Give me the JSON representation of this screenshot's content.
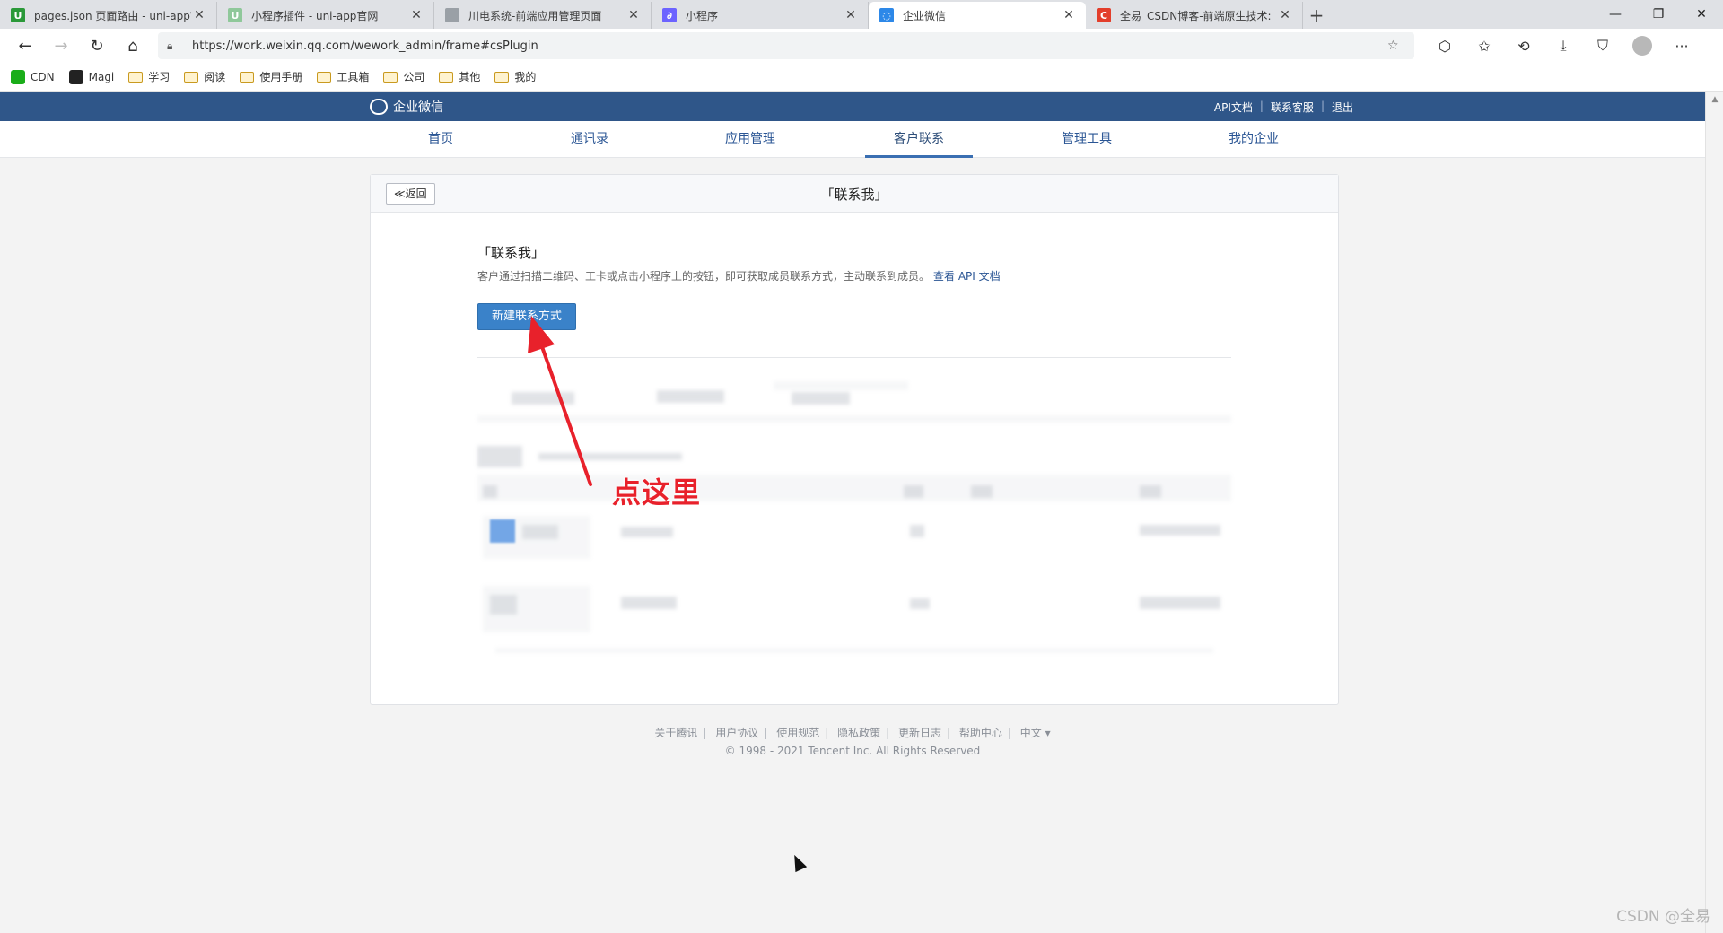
{
  "browser": {
    "tabs": [
      {
        "title": "pages.json 页面路由 - uni-app官",
        "favicon_color": "#2b9939",
        "favicon_glyph": "U",
        "active": false
      },
      {
        "title": "小程序插件 - uni-app官网",
        "favicon_color": "#8fc89a",
        "favicon_glyph": "U",
        "active": false
      },
      {
        "title": "川电系统-前端应用管理页面",
        "favicon_color": "#9aa0a6",
        "favicon_glyph": "",
        "active": false
      },
      {
        "title": "小程序",
        "favicon_color": "#6c63ff",
        "favicon_glyph": "∂",
        "active": false
      },
      {
        "title": "企业微信",
        "favicon_color": "#2d88e8",
        "favicon_glyph": "◌",
        "active": true
      },
      {
        "title": "全易_CSDN博客-前端原生技术:",
        "favicon_color": "#e33e2b",
        "favicon_glyph": "C",
        "active": false
      }
    ],
    "url": "https://work.weixin.qq.com/wework_admin/frame#csPlugin",
    "bookmarks": [
      {
        "label": "CDN",
        "type": "site",
        "color": "#1aad19"
      },
      {
        "label": "Magi",
        "type": "site",
        "color": "#222222"
      },
      {
        "label": "学习",
        "type": "folder"
      },
      {
        "label": "阅读",
        "type": "folder"
      },
      {
        "label": "使用手册",
        "type": "folder"
      },
      {
        "label": "工具箱",
        "type": "folder"
      },
      {
        "label": "公司",
        "type": "folder"
      },
      {
        "label": "其他",
        "type": "folder"
      },
      {
        "label": "我的",
        "type": "folder"
      }
    ]
  },
  "header": {
    "logo": "企业微信",
    "links": [
      "API文档",
      "联系客服",
      "退出"
    ]
  },
  "nav": {
    "items": [
      "首页",
      "通讯录",
      "应用管理",
      "客户联系",
      "管理工具",
      "我的企业"
    ],
    "active_index": 3
  },
  "card": {
    "back_label": "≪返回",
    "title": "「联系我」",
    "section_title": "「联系我」",
    "description": "客户通过扫描二维码、工卡或点击小程序上的按钮，即可获取成员联系方式，主动联系到成员。",
    "api_link": "查看 API 文档",
    "new_button": "新建联系方式"
  },
  "annotation": {
    "text": "点这里",
    "color": "#e8212b"
  },
  "footer": {
    "links": [
      "关于腾讯",
      "用户协议",
      "使用规范",
      "隐私政策",
      "更新日志",
      "帮助中心",
      "中文 ▾"
    ],
    "copyright": "© 1998 - 2021 Tencent Inc. All Rights Reserved"
  },
  "watermark": "CSDN @全易"
}
